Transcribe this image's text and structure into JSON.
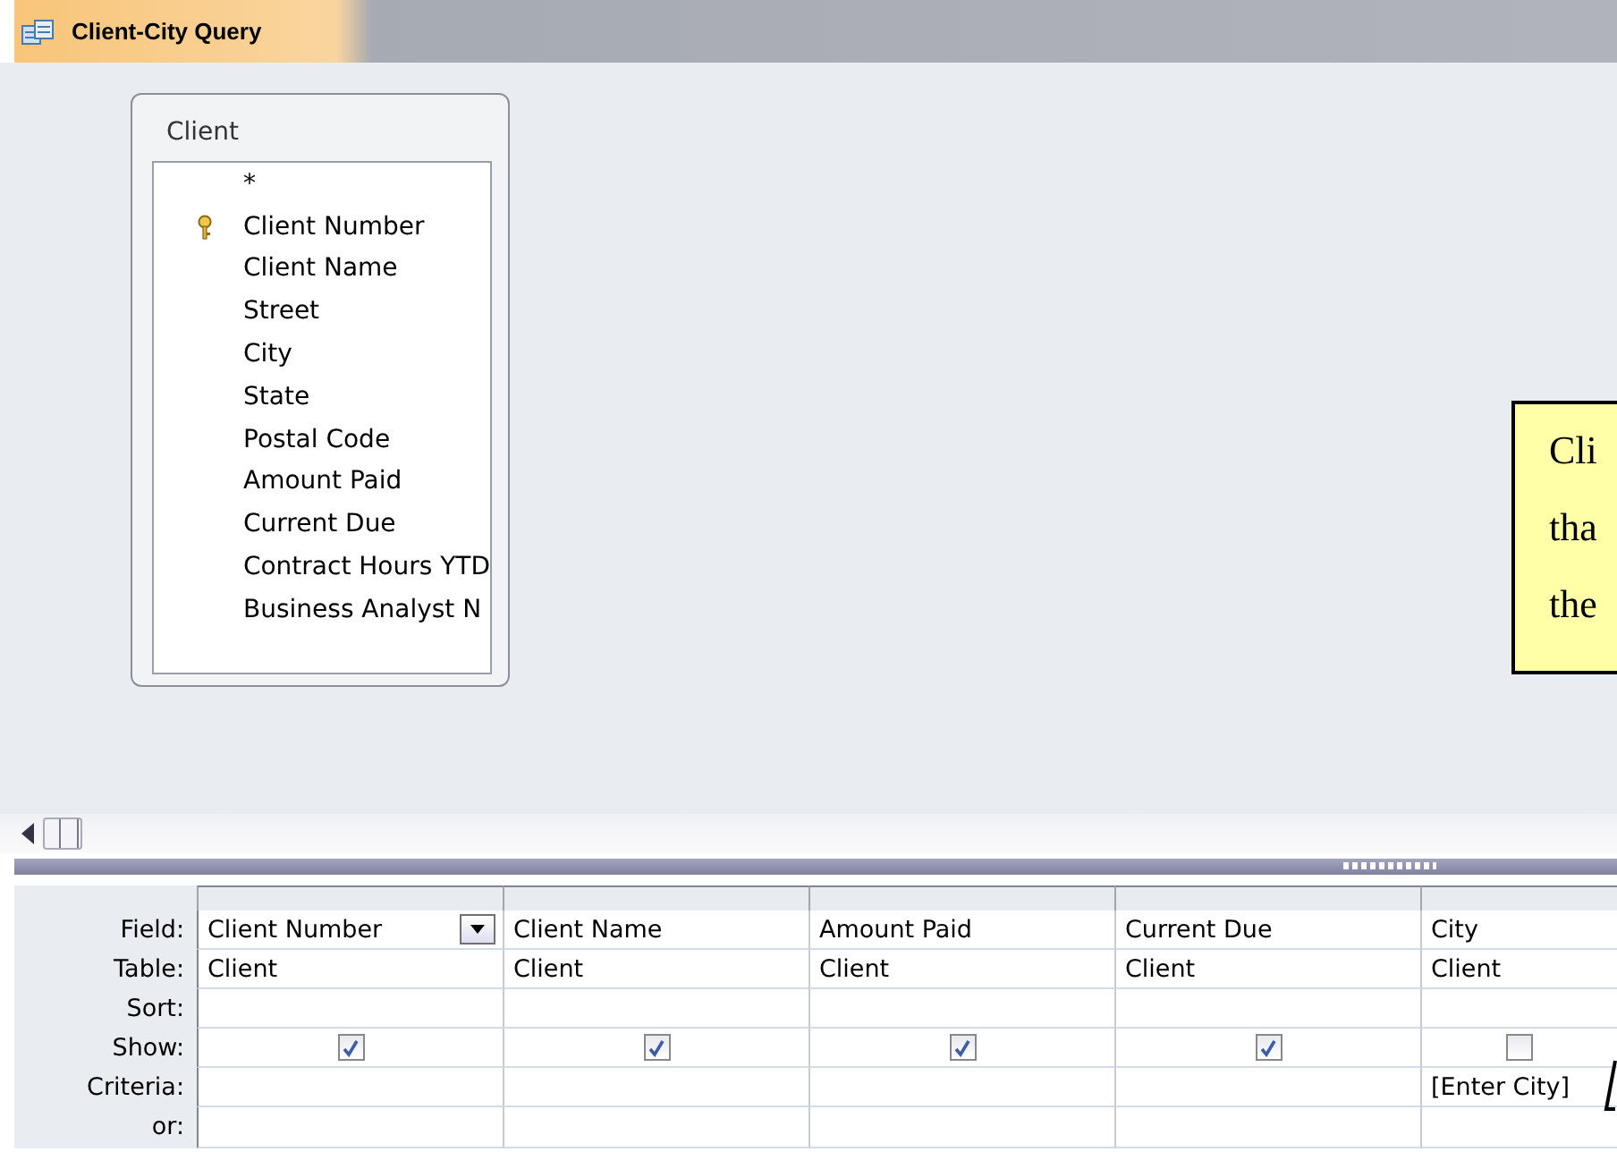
{
  "tab": {
    "title": "Client-City Query",
    "selected": true
  },
  "table_box": {
    "title": "Client",
    "fields": [
      {
        "name": "*",
        "primary_key": false
      },
      {
        "name": "Client Number",
        "primary_key": true
      },
      {
        "name": "Client Name",
        "primary_key": false
      },
      {
        "name": "Street",
        "primary_key": false
      },
      {
        "name": "City",
        "primary_key": false
      },
      {
        "name": "State",
        "primary_key": false
      },
      {
        "name": "Postal Code",
        "primary_key": false
      },
      {
        "name": "Amount Paid",
        "primary_key": false
      },
      {
        "name": "Current Due",
        "primary_key": false
      },
      {
        "name": "Contract Hours YTD",
        "primary_key": false
      },
      {
        "name": "Business Analyst N",
        "primary_key": false
      }
    ]
  },
  "callout": {
    "lines": [
      "Cli",
      "tha",
      "the"
    ]
  },
  "grid": {
    "row_labels": [
      "Field:",
      "Table:",
      "Sort:",
      "Show:",
      "Criteria:",
      "or:"
    ],
    "columns": [
      {
        "field": "Client Number",
        "table": "Client",
        "show": true,
        "dropdown": true
      },
      {
        "field": "Client Name",
        "table": "Client",
        "show": true,
        "dropdown": false
      },
      {
        "field": "Amount Paid",
        "table": "Client",
        "show": true,
        "dropdown": false
      },
      {
        "field": "Current Due",
        "table": "Client",
        "show": true,
        "dropdown": false
      },
      {
        "field": "City",
        "table": "Client",
        "show": false,
        "criteria": "[Enter City]",
        "dropdown": false
      }
    ]
  }
}
